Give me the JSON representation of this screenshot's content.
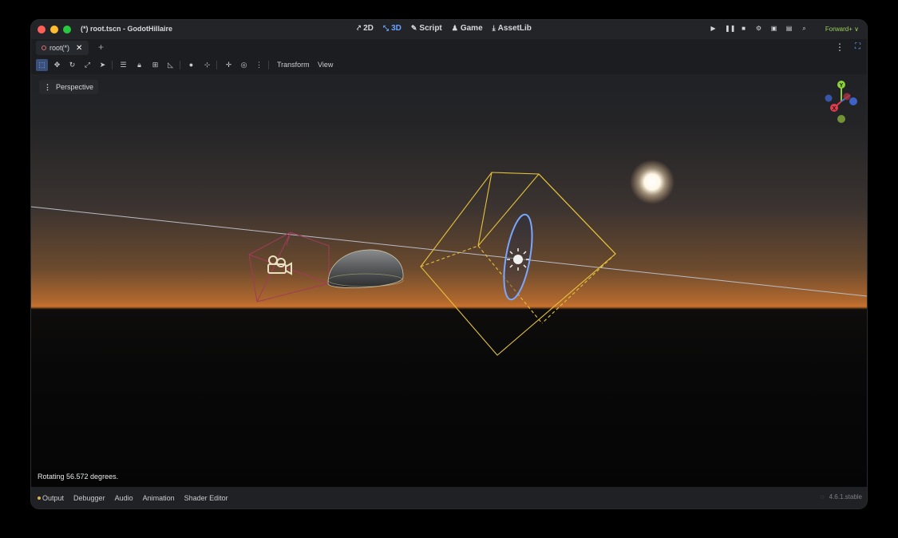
{
  "window": {
    "title": "(*) root.tscn - GodotHillaire"
  },
  "main_tabs": [
    {
      "label": "2D",
      "icon": "2d-icon",
      "active": false
    },
    {
      "label": "3D",
      "icon": "3d-icon",
      "active": true
    },
    {
      "label": "Script",
      "icon": "script-icon",
      "active": false
    },
    {
      "label": "Game",
      "icon": "game-icon",
      "active": false
    },
    {
      "label": "AssetLib",
      "icon": "assetlib-icon",
      "active": false
    }
  ],
  "run_controls": [
    "play-icon",
    "pause-icon",
    "stop-icon",
    "remote-debug-icon",
    "movie-icon",
    "pin-icon",
    "search-icon"
  ],
  "renderer": "Forward+ ∨",
  "scene_tab": {
    "label": "root(*)"
  },
  "toolbar": {
    "icons": [
      "select-icon",
      "move-icon",
      "rotate-icon",
      "scale-icon",
      "pointer-icon",
      "list-icon",
      "lock-icon",
      "group-icon",
      "ruler-icon",
      "sphere-icon",
      "snap-icon",
      "plus-icon",
      "circle-icon",
      "more-icon"
    ],
    "menus": [
      "Transform",
      "View"
    ]
  },
  "viewport": {
    "view_mode": "Perspective",
    "status": "Rotating 56.572 degrees.",
    "gizmo_axes": [
      "Y",
      "X"
    ]
  },
  "bottom_tabs": [
    "Output",
    "Debugger",
    "Audio",
    "Animation",
    "Shader Editor"
  ],
  "version": "4.6.1.stable",
  "colors": {
    "accent": "#6aa2ff",
    "renderer": "#9ad05a",
    "selection": "#e6c23c",
    "light_ring": "#7aa7ff"
  }
}
